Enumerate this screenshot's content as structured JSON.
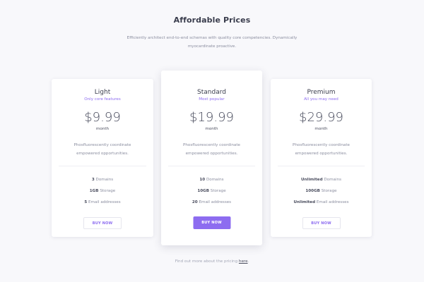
{
  "header": {
    "title": "Affordable Prices",
    "subtitle": "Efficiently architect end-to-end schemas with quality core competencies. Dynamically myocardinate proactive."
  },
  "plans": [
    {
      "name": "Light",
      "tagline": "Only core features",
      "price": "$9.99",
      "period": "month",
      "description": "Phosfluorescently coordinate empowered opportunities.",
      "features": [
        {
          "value": "3",
          "label": "Domains"
        },
        {
          "value": "1GB",
          "label": "Storage"
        },
        {
          "value": "5",
          "label": "Email addresses"
        }
      ],
      "button": "BUY NOW"
    },
    {
      "name": "Standard",
      "tagline": "Most popular",
      "price": "$19.99",
      "period": "month",
      "description": "Phosfluorescently coordinate empowered opportunities.",
      "features": [
        {
          "value": "10",
          "label": "Domains"
        },
        {
          "value": "10GB",
          "label": "Storage"
        },
        {
          "value": "20",
          "label": "Email addresses"
        }
      ],
      "button": "BUY NOW"
    },
    {
      "name": "Premium",
      "tagline": "All you may need",
      "price": "$29.99",
      "period": "month",
      "description": "Phosfluorescently coordinate empowered opportunities.",
      "features": [
        {
          "value": "Unlimited",
          "label": "Domains"
        },
        {
          "value": "100GB",
          "label": "Storage"
        },
        {
          "value": "Unlimited",
          "label": "Email addresses"
        }
      ],
      "button": "BUY NOW"
    }
  ],
  "footer": {
    "text": "Find out more about the pricing",
    "link": "here",
    "end": "."
  },
  "colors": {
    "accent": "#8d6cf0",
    "background": "#f8f8fb",
    "card": "#ffffff"
  }
}
